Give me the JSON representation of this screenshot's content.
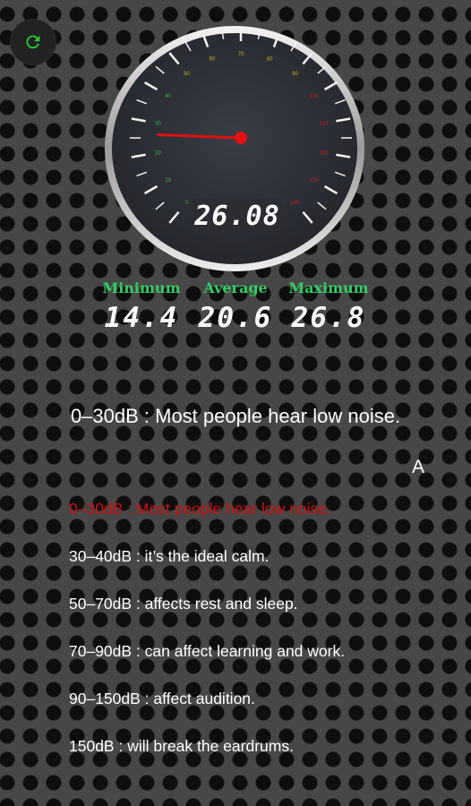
{
  "gauge": {
    "reading": "26.08",
    "needle_value": 26.08,
    "scale_labels": [
      "0",
      "10",
      "20",
      "30",
      "40",
      "50",
      "60",
      "70",
      "80",
      "90",
      "100",
      "110",
      "120",
      "130",
      "140"
    ]
  },
  "stats": {
    "minimum_label": "Minimum",
    "minimum_value": "14.4",
    "average_label": "Average",
    "average_value": "20.6",
    "maximum_label": "Maximum",
    "maximum_value": "26.8"
  },
  "headline": "0–30dB : Most people hear low noise.",
  "font_toggle": "A",
  "levels": [
    "0–30dB : Most people hear low noise.",
    "30–40dB : it’s the ideal calm.",
    "50–70dB : affects rest and sleep.",
    "70–90dB : can affect learning and work.",
    "90–150dB : affect audition.",
    "150dB : will break the eardrums."
  ],
  "colors": {
    "accent_green": "#33cc66",
    "active_level": "#cc1111",
    "needle": "#e01010"
  },
  "icons": {
    "refresh": "refresh-icon"
  }
}
